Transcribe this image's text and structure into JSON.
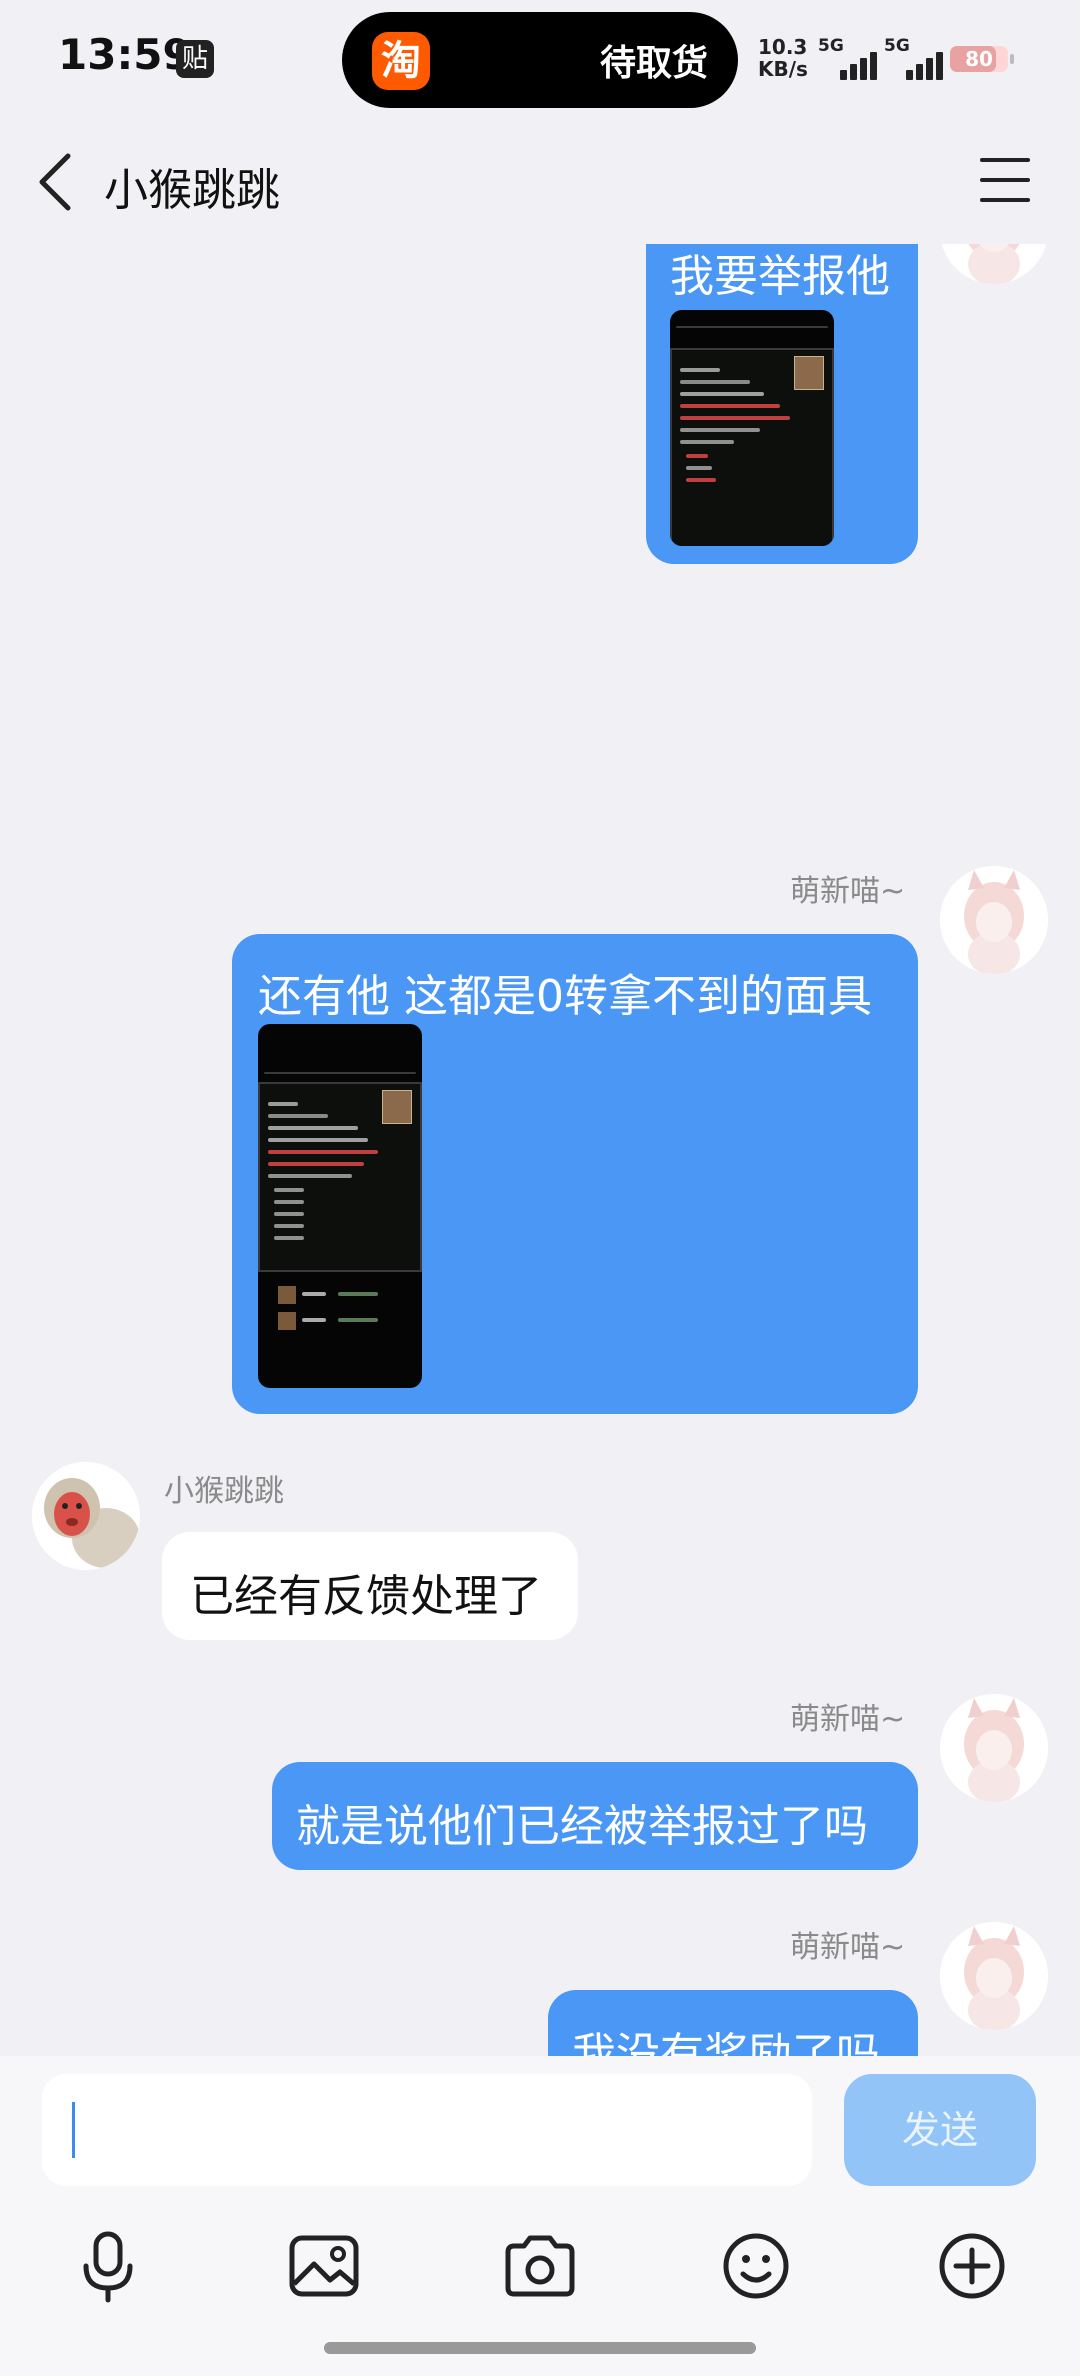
{
  "status_bar": {
    "time": "13:59",
    "sticker_badge": "贴",
    "island_app_icon": "淘",
    "island_text": "待取货",
    "speed_value": "10.3",
    "speed_unit": "KB/s",
    "sim1_label": "5G",
    "sim2_label": "5G",
    "battery_level": "80"
  },
  "header": {
    "title": "小猴跳跳"
  },
  "messages": [
    {
      "sender": "",
      "text": "我要举报他",
      "direction": "outgoing",
      "has_image": true
    },
    {
      "sender": "萌新喵~",
      "text": "还有他  这都是0转拿不到的面具",
      "direction": "outgoing",
      "has_image": true
    },
    {
      "sender": "小猴跳跳",
      "text": "已经有反馈处理了",
      "direction": "incoming",
      "has_image": false
    },
    {
      "sender": "萌新喵~",
      "text": "就是说他们已经被举报过了吗",
      "direction": "outgoing",
      "has_image": false
    },
    {
      "sender": "萌新喵~",
      "text": "我没有奖励了吗",
      "direction": "outgoing",
      "has_image": false
    }
  ],
  "input": {
    "send_label": "发送"
  },
  "toolbar": {
    "icons": [
      "microphone-icon",
      "image-icon",
      "camera-icon",
      "emoji-icon",
      "plus-icon"
    ]
  },
  "colors": {
    "outgoing_bubble": "#4a97f5",
    "incoming_bubble": "#ffffff",
    "background": "#f1f1f5",
    "send_button_disabled": "#93c4f8"
  }
}
